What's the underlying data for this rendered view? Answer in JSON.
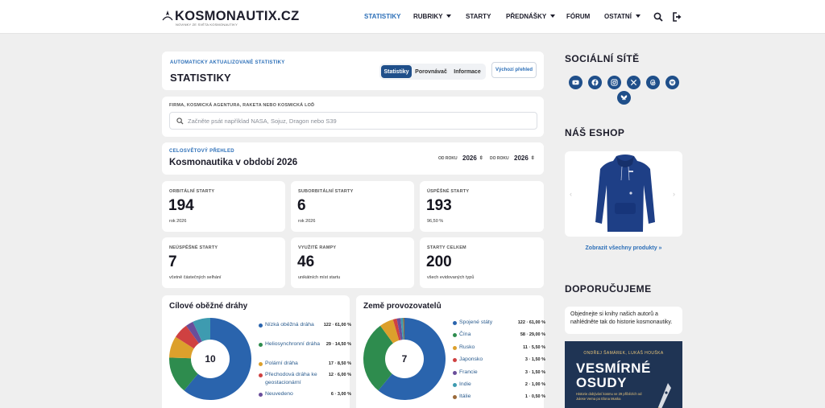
{
  "header": {
    "logo_text": "KOSMONAUTIX.CZ",
    "logo_sub": "NOVINKY ZE SVĚTA KOSMONAUTIKY",
    "nav": [
      {
        "label": "STATISTIKY",
        "active": true,
        "dropdown": false
      },
      {
        "label": "RUBRIKY",
        "active": false,
        "dropdown": true
      },
      {
        "label": "STARTY",
        "active": false,
        "dropdown": false
      },
      {
        "label": "PŘEDNÁŠKY",
        "active": false,
        "dropdown": true
      },
      {
        "label": "FÓRUM",
        "active": false,
        "dropdown": false
      },
      {
        "label": "OSTATNÍ",
        "active": false,
        "dropdown": true
      }
    ],
    "icons": [
      "search-icon",
      "logout-icon"
    ]
  },
  "stats_header": {
    "kicker": "AUTOMATICKY AKTUALIZOVANÉ STATISTIKY",
    "title": "STATISTIKY",
    "tabs": [
      "Statistiky",
      "Porovnávač",
      "Informace"
    ],
    "active_tab": "Statistiky",
    "overview_button": "Výchozí přehled"
  },
  "search": {
    "label": "FIRMA, KOSMICKÁ AGENTURA, RAKETA NEBO KOSMICKÁ LOĎ",
    "placeholder": "Začněte psát například NASA, Sojuz, Dragon nebo S39"
  },
  "period": {
    "kicker": "CELOSVĚTOVÝ PŘEHLED",
    "title": "Kosmonautika v období 2026",
    "from_label": "OD ROKU",
    "from_value": "2026",
    "to_label": "DO ROKU",
    "to_value": "2026"
  },
  "stats": [
    {
      "label": "ORBITÁLNÍ STARTY",
      "value": "194",
      "sub": "rok 2026"
    },
    {
      "label": "SUBORBITÁLNÍ STARTY",
      "value": "6",
      "sub": "rok 2026"
    },
    {
      "label": "ÚSPĚŠNÉ STARTY",
      "value": "193",
      "sub": "96,50 %"
    },
    {
      "label": "NEÚSPĚŠNÉ STARTY",
      "value": "7",
      "sub": "včetně částečných selhání"
    },
    {
      "label": "VYUŽITÉ RAMPY",
      "value": "46",
      "sub": "unikátních míst startu"
    },
    {
      "label": "STARTY CELKEM",
      "value": "200",
      "sub": "všech evidovaných typů"
    }
  ],
  "chart_data": [
    {
      "type": "pie",
      "title": "Cílové oběžné dráhy",
      "center_label": "10",
      "categories": [
        "Nízká oběžná dráha",
        "Heliosynchronní dráha",
        "Polární dráha",
        "Přechodová dráha ke geostacionární",
        "Neuvedeno"
      ],
      "values": [
        122,
        29,
        17,
        12,
        6
      ],
      "value_labels": [
        "122 · 61,00 %",
        "29 · 14,50 %",
        "17 · 8,50 %",
        "12 · 6,00 %",
        "6 · 3,00 %"
      ],
      "colors": [
        "#2a64ad",
        "#2e8c4e",
        "#dca02c",
        "#cf4141",
        "#6a4e9a",
        "#3e9bb0",
        "#9a6a3a",
        "#c9629b",
        "#7a8b3a",
        "#4a5a6a"
      ],
      "total_for_chart": 200
    },
    {
      "type": "pie",
      "title": "Země provozovatelů",
      "center_label": "7",
      "categories": [
        "Spojené státy",
        "Čína",
        "Rusko",
        "Japonsko",
        "Francie",
        "Indie",
        "Itálie"
      ],
      "values": [
        122,
        58,
        11,
        3,
        3,
        2,
        1
      ],
      "value_labels": [
        "122 · 61,00 %",
        "58 · 29,00 %",
        "11 · 5,50 %",
        "3 · 1,50 %",
        "3 · 1,50 %",
        "2 · 1,00 %",
        "1 · 0,50 %"
      ],
      "colors": [
        "#2a64ad",
        "#2e8c4e",
        "#dca02c",
        "#cf4141",
        "#6a4e9a",
        "#3e9bb0",
        "#9a6a3a"
      ]
    }
  ],
  "sidebar": {
    "social_title": "SOCIÁLNÍ SÍTĚ",
    "social_icons": [
      "youtube-icon",
      "facebook-icon",
      "instagram-icon",
      "x-icon",
      "threads-icon",
      "spotify-icon",
      "bluesky-icon"
    ],
    "shop_title": "NÁŠ ESHOP",
    "shop_link": "Zobrazit všechny produkty »",
    "recommend_title": "DOPORUČUJEME",
    "recommend_text": "Objednejte si knihy našich autorů a nahlédněte tak do historie kosmonautiky.",
    "book": {
      "authors": "ONDŘEJ ŠAMÁREK, LUKÁŠ HOUŠKA",
      "title_line1": "VESMÍRNÉ",
      "title_line2": "OSUDY",
      "subtitle": "Historie dobývání kosmu ve 29 příbězích od Julese Verna po Elona Muska"
    }
  },
  "colors": {
    "accent": "#2c6fb8",
    "brand_dark": "#1f4f8a"
  }
}
